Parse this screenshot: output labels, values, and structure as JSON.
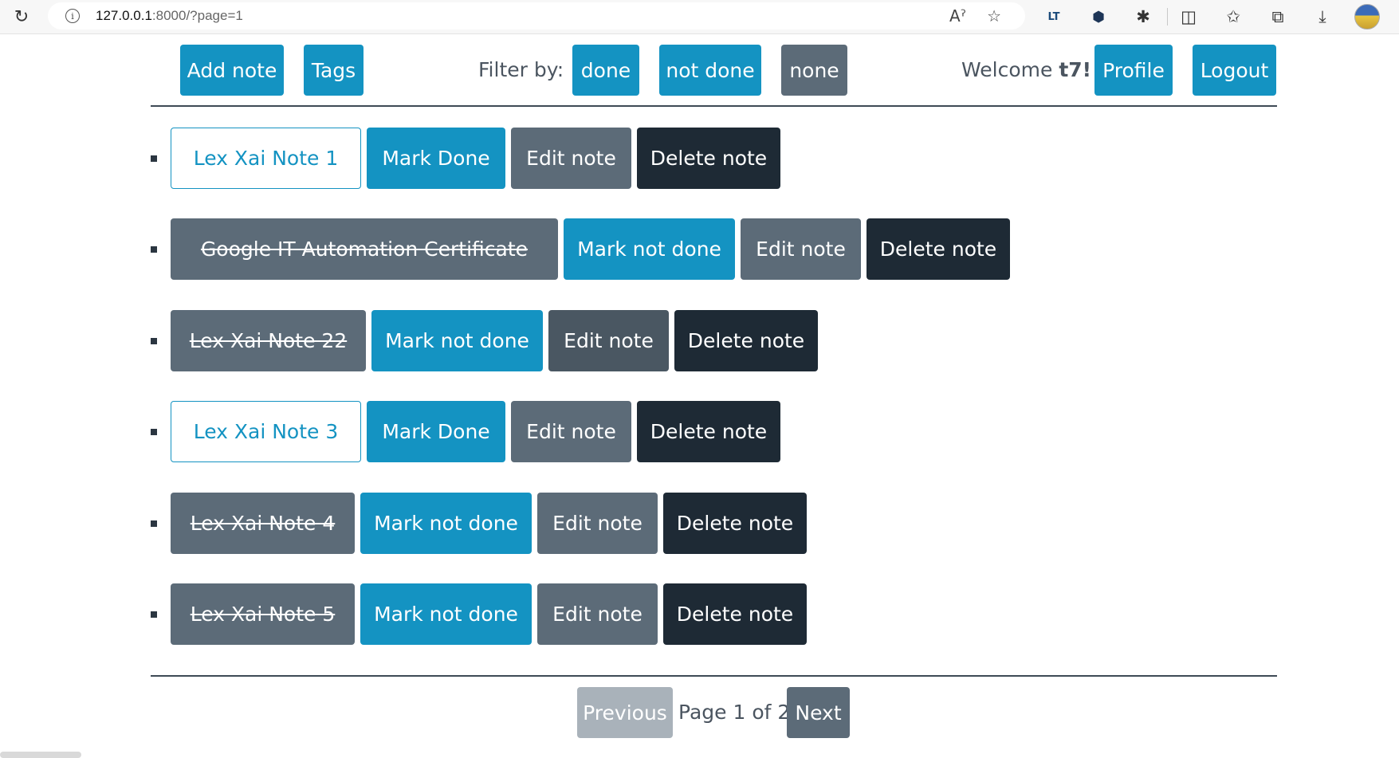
{
  "browser": {
    "url_host": "127.0.0.1",
    "url_rest": ":8000/?page=1"
  },
  "nav": {
    "add_note": "Add note",
    "tags": "Tags",
    "filter_label": "Filter by:",
    "filter_done": "done",
    "filter_not_done": "not done",
    "filter_none": "none",
    "welcome_prefix": "Welcome ",
    "username": "t7!",
    "profile": "Profile",
    "logout": "Logout"
  },
  "notes": [
    {
      "title": "Lex Xai Note 1",
      "done": false,
      "toggle_label": "Mark Done",
      "edit_label": "Edit note",
      "delete_label": "Delete note"
    },
    {
      "title": "Google IT Automation Certificate",
      "done": true,
      "toggle_label": "Mark not done",
      "edit_label": "Edit note",
      "delete_label": "Delete note"
    },
    {
      "title": "Lex Xai Note 22",
      "done": true,
      "toggle_label": "Mark not done",
      "edit_label": "Edit note",
      "delete_label": "Delete note"
    },
    {
      "title": "Lex Xai Note 3",
      "done": false,
      "toggle_label": "Mark Done",
      "edit_label": "Edit note",
      "delete_label": "Delete note"
    },
    {
      "title": "Lex Xai Note 4",
      "done": true,
      "toggle_label": "Mark not done",
      "edit_label": "Edit note",
      "delete_label": "Delete note"
    },
    {
      "title": "Lex Xai Note 5",
      "done": true,
      "toggle_label": "Mark not done",
      "edit_label": "Edit note",
      "delete_label": "Delete note"
    }
  ],
  "pagination": {
    "previous": "Previous",
    "status": "Page 1 of 2.",
    "next": "Next"
  }
}
